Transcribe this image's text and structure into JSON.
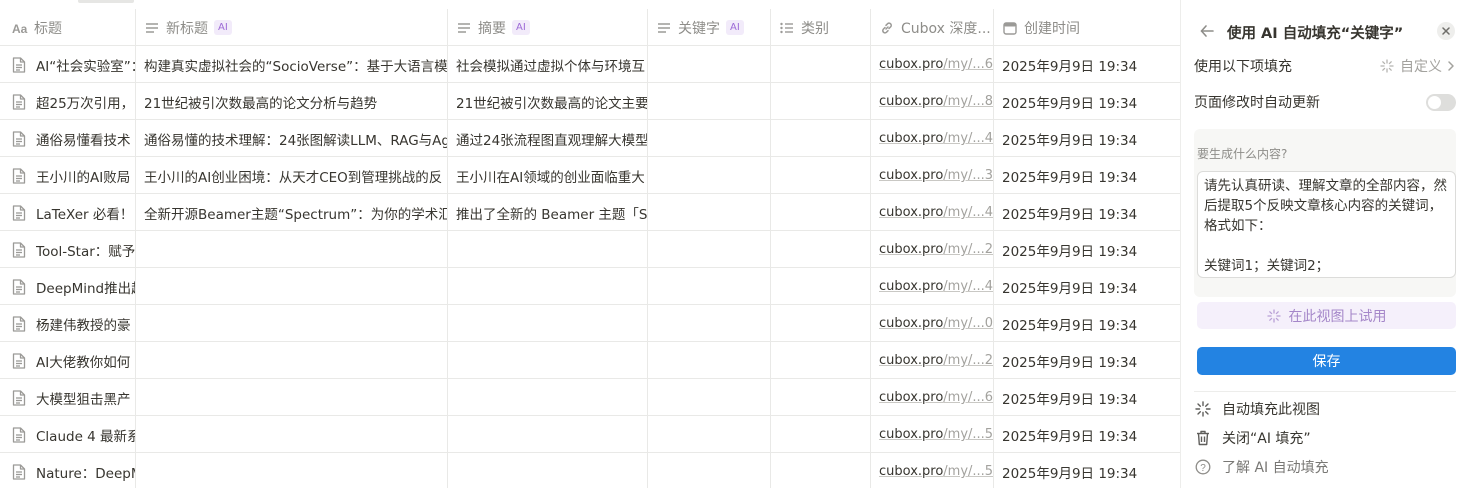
{
  "columns": {
    "title": {
      "label": "标题",
      "icon": "text-aa-icon"
    },
    "new_title": {
      "label": "新标题",
      "ai": "AI",
      "icon": "text-lines-icon"
    },
    "summary": {
      "label": "摘要",
      "ai": "AI",
      "icon": "text-lines-icon"
    },
    "keywords": {
      "label": "关键字",
      "ai": "AI",
      "icon": "text-lines-icon"
    },
    "category": {
      "label": "类别",
      "icon": "list-icon"
    },
    "cubox": {
      "label": "Cubox 深度...",
      "icon": "link-icon"
    },
    "created": {
      "label": "创建时间",
      "icon": "clock-icon"
    }
  },
  "rows": [
    {
      "title": "AI“社会实验室”：",
      "new_title": "构建真实虚拟社会的“SocioVerse”：基于大语言模型",
      "summary": "社会模拟通过虚拟个体与环境互",
      "keywords": "",
      "category": "",
      "url_host": "cubox.pro",
      "url_path": "/my/...67",
      "created": "2025年9月9日 19:34"
    },
    {
      "title": "超25万次引用，",
      "new_title": "21世纪被引次数最高的论文分析与趋势",
      "summary": "21世纪被引次数最高的论文主要",
      "keywords": "",
      "category": "",
      "url_host": "cubox.pro",
      "url_path": "/my/...80",
      "created": "2025年9月9日 19:34"
    },
    {
      "title": "通俗易懂看技术",
      "new_title": "通俗易懂的技术理解：24张图解读LLM、RAG与Ag",
      "summary": "通过24张流程图直观理解大模型",
      "keywords": "",
      "category": "",
      "url_host": "cubox.pro",
      "url_path": "/my/...45",
      "created": "2025年9月9日 19:34"
    },
    {
      "title": "王小川的AI败局",
      "new_title": "王小川的AI创业困境：从天才CEO到管理挑战的反",
      "summary": "王小川在AI领域的创业面临重大",
      "keywords": "",
      "category": "",
      "url_host": "cubox.pro",
      "url_path": "/my/...36",
      "created": "2025年9月9日 19:34"
    },
    {
      "title": "LaTeXer 必看！",
      "new_title": "全新开源Beamer主题“Spectrum”：为你的学术汇报",
      "summary": "推出了全新的 Beamer 主题「Sp",
      "keywords": "",
      "category": "",
      "url_host": "cubox.pro",
      "url_path": "/my/...42",
      "created": "2025年9月9日 19:34"
    },
    {
      "title": "Tool-Star：赋予",
      "new_title": "",
      "summary": "",
      "keywords": "",
      "category": "",
      "url_host": "cubox.pro",
      "url_path": "/my/...22",
      "created": "2025年9月9日 19:34"
    },
    {
      "title": "DeepMind推出超",
      "new_title": "",
      "summary": "",
      "keywords": "",
      "category": "",
      "url_host": "cubox.pro",
      "url_path": "/my/...45",
      "created": "2025年9月9日 19:34"
    },
    {
      "title": "杨建伟教授的豪",
      "new_title": "",
      "summary": "",
      "keywords": "",
      "category": "",
      "url_host": "cubox.pro",
      "url_path": "/my/...04",
      "created": "2025年9月9日 19:34"
    },
    {
      "title": "AI大佬教你如何",
      "new_title": "",
      "summary": "",
      "keywords": "",
      "category": "",
      "url_host": "cubox.pro",
      "url_path": "/my/...22",
      "created": "2025年9月9日 19:34"
    },
    {
      "title": "大模型狙击黑产",
      "new_title": "",
      "summary": "",
      "keywords": "",
      "category": "",
      "url_host": "cubox.pro",
      "url_path": "/my/...68",
      "created": "2025年9月9日 19:34"
    },
    {
      "title": "Claude 4 最新系",
      "new_title": "",
      "summary": "",
      "keywords": "",
      "category": "",
      "url_host": "cubox.pro",
      "url_path": "/my/...57",
      "created": "2025年9月9日 19:34"
    },
    {
      "title": "Nature：DeepM",
      "new_title": "",
      "summary": "",
      "keywords": "",
      "category": "",
      "url_host": "cubox.pro",
      "url_path": "/my/...53",
      "created": "2025年9月9日 19:34"
    }
  ],
  "panel": {
    "title": "使用 AI 自动填充“关键字”",
    "fill_with_label": "使用以下项填充",
    "fill_with_value": "自定义",
    "auto_update_label": "页面修改时自动更新",
    "auto_update_on": false,
    "prompt_label": "要生成什么内容?",
    "prompt_text": "请先认真研读、理解文章的全部内容，然后提取5个反映文章核心内容的关键词，格式如下：\n\n关键词1；关键词2；",
    "try_button": "在此视图上试用",
    "save_button": "保存",
    "menu": [
      {
        "label": "自动填充此视图",
        "icon": "sparkle-icon"
      },
      {
        "label": "关闭“AI 填充”",
        "icon": "trash-icon"
      },
      {
        "label": "了解 AI 自动填充",
        "icon": "help-circle-icon"
      }
    ]
  },
  "colors": {
    "accent": "#2383e2",
    "ai_tag": "#9d6ad6",
    "border": "#e9e9e7",
    "muted_text": "#8e8d89"
  }
}
